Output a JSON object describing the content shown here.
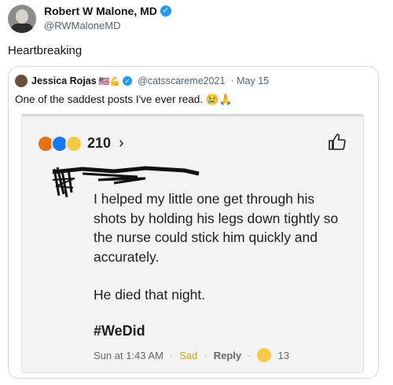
{
  "tweet": {
    "author_name": "Robert W Malone, MD",
    "author_handle": "@RWMaloneMD",
    "text": "Heartbreaking"
  },
  "quote": {
    "author_name": "Jessica Rojas",
    "author_emojis": "🇺🇸💪",
    "author_handle": "@catsscareme2021",
    "date": "· May 15",
    "text": "One of the saddest posts I've ever read. 😢🙏",
    "fb_post": {
      "reaction_count": "210",
      "chevron": "›",
      "paragraph_1": "I helped my little one get through his shots by holding his legs down tightly so the nurse could stick him quickly and accurately.",
      "paragraph_2": "He died that night.",
      "hashtag": "#WeDid",
      "timestamp": "Sun at 1:43 AM",
      "reaction_label": "Sad",
      "reply_label": "Reply",
      "reply_reaction_count": "13",
      "colors": {
        "sad_label": "#c9a21f",
        "like_blue": "#1877f2",
        "angry_orange": "#e9710f"
      }
    }
  },
  "icons": [
    "verified-badge-icon",
    "angry-reaction-icon",
    "like-reaction-icon",
    "sad-reaction-icon",
    "chevron-right-icon",
    "thumbs-up-icon"
  ]
}
